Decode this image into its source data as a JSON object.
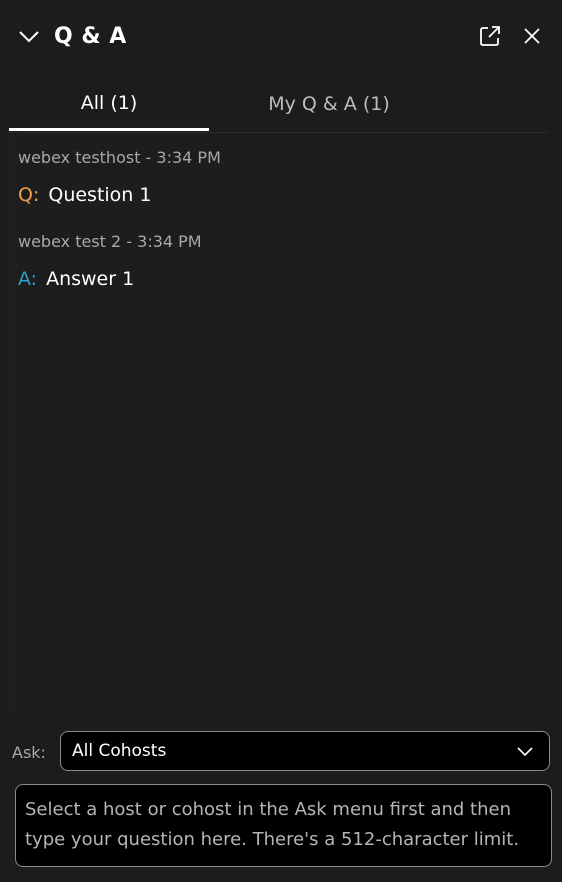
{
  "header": {
    "title": "Q & A",
    "collapse_icon": "chevron-down-icon",
    "popout_icon": "popout-icon",
    "close_icon": "close-icon"
  },
  "tabs": [
    {
      "label": "All (1)",
      "active": true
    },
    {
      "label": "My Q & A (1)",
      "active": false
    }
  ],
  "entries": [
    {
      "meta": "webex testhost - 3:34 PM",
      "prefix": "Q:",
      "text": "Question 1"
    },
    {
      "meta": "webex test 2 - 3:34 PM",
      "prefix": "A:",
      "text": "Answer 1"
    }
  ],
  "ask": {
    "label": "Ask:",
    "selected": "All Cohosts"
  },
  "question_input": {
    "placeholder": "Select a host or cohost in the Ask menu first and then type your question here. There's a 512-character limit.",
    "value": ""
  },
  "colors": {
    "background": "#1c1c1c",
    "question_prefix": "#f0a248",
    "answer_prefix": "#2aa1c8"
  }
}
